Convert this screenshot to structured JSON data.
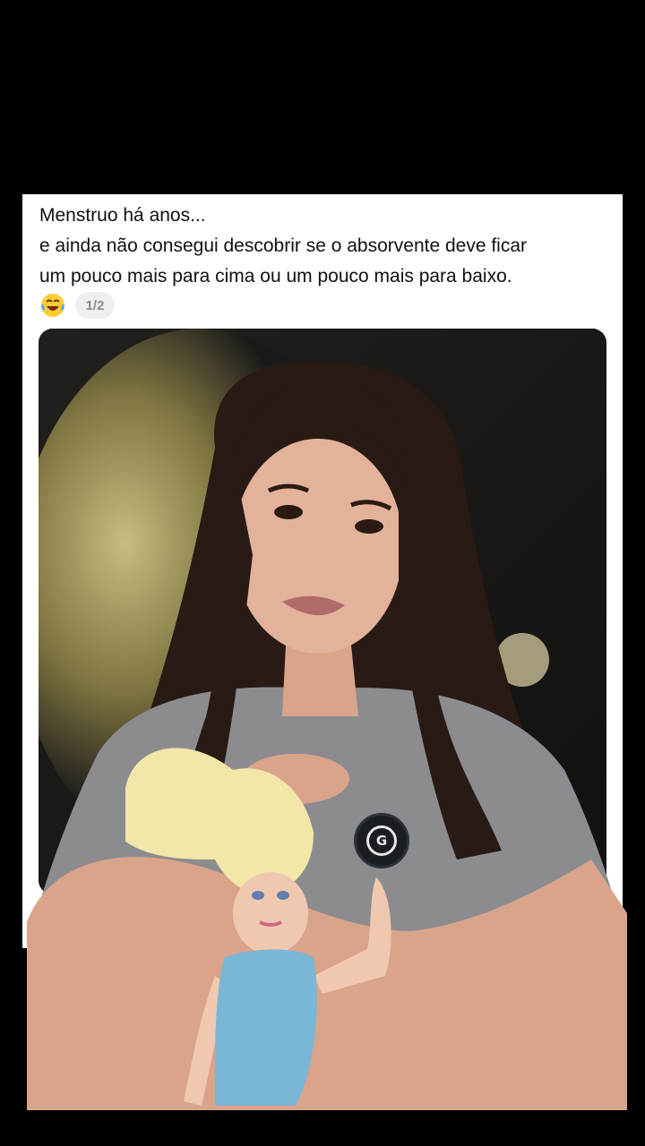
{
  "post": {
    "line1": "Menstruo há anos...",
    "line2": "e ainda não consegui descobrir se o absorvente deve ficar",
    "line3": "um pouco mais para cima ou um pouco mais para baixo.",
    "emoji": "laughing-with-tears-emoji",
    "page_indicator": "1/2"
  },
  "icons": {
    "microphone": "wireless-microphone-icon",
    "indicator": "red-dot-indicator"
  },
  "colors": {
    "card_background": "#ffffff",
    "page_background": "#000000",
    "indicator_dot": "#e0245e"
  }
}
